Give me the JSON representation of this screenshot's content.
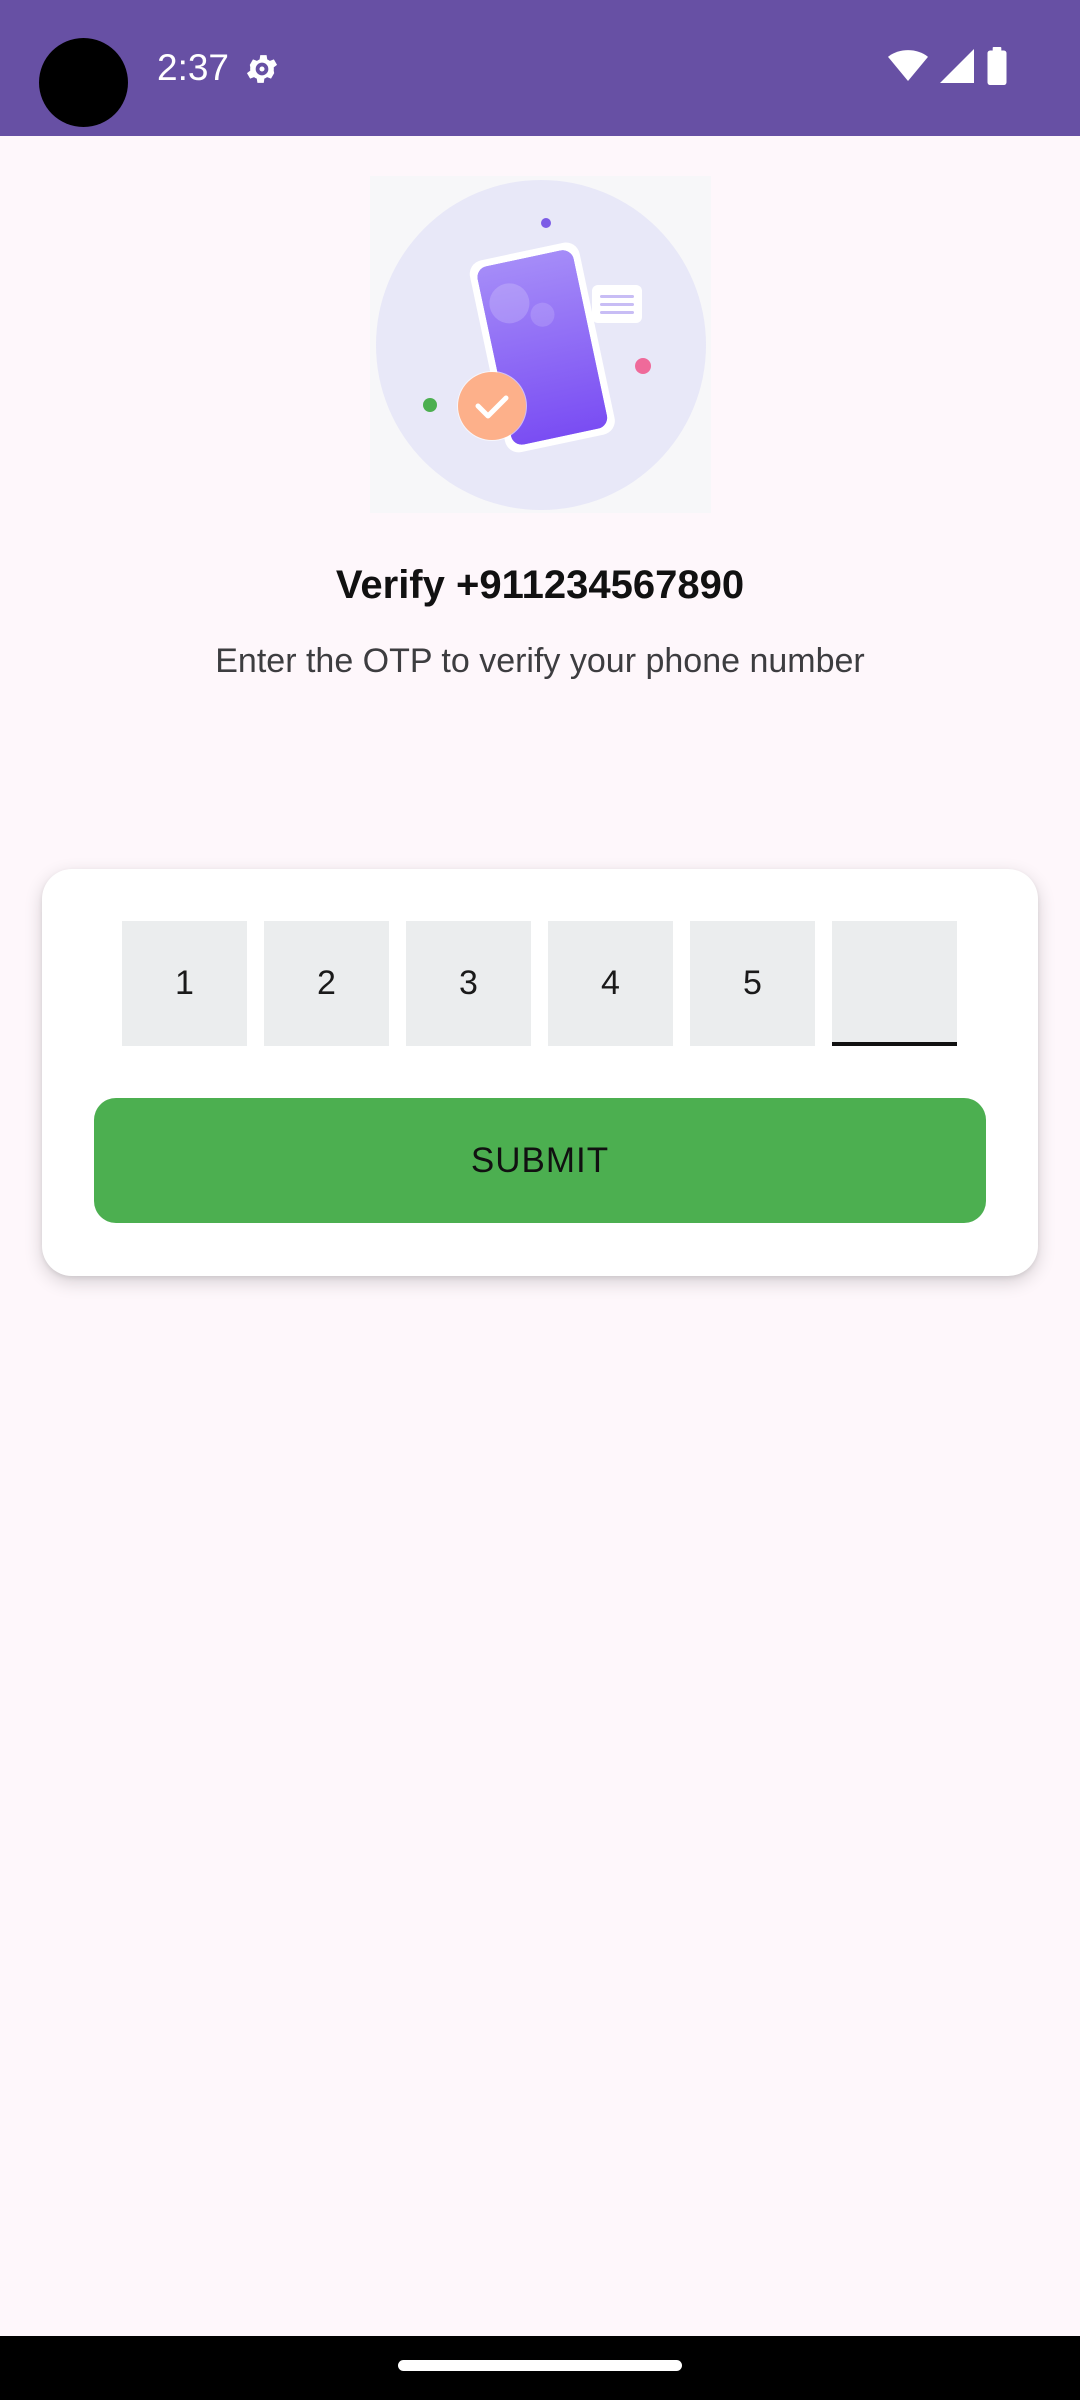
{
  "status_bar": {
    "time": "2:37",
    "icons": [
      "settings-icon",
      "wifi-icon",
      "signal-icon",
      "battery-icon"
    ]
  },
  "hero": {
    "icon": "phone-verified-illustration"
  },
  "verify": {
    "title": "Verify +911234567890",
    "subtitle": "Enter the OTP to verify your phone number"
  },
  "otp": {
    "digits": [
      "1",
      "2",
      "3",
      "4",
      "5",
      ""
    ],
    "active_index": 5
  },
  "submit": {
    "label": "SUBMIT"
  },
  "colors": {
    "status_bar": "#6750a4",
    "background": "#fef7fb",
    "submit_button": "#4caf50",
    "otp_box": "#ebedee"
  }
}
